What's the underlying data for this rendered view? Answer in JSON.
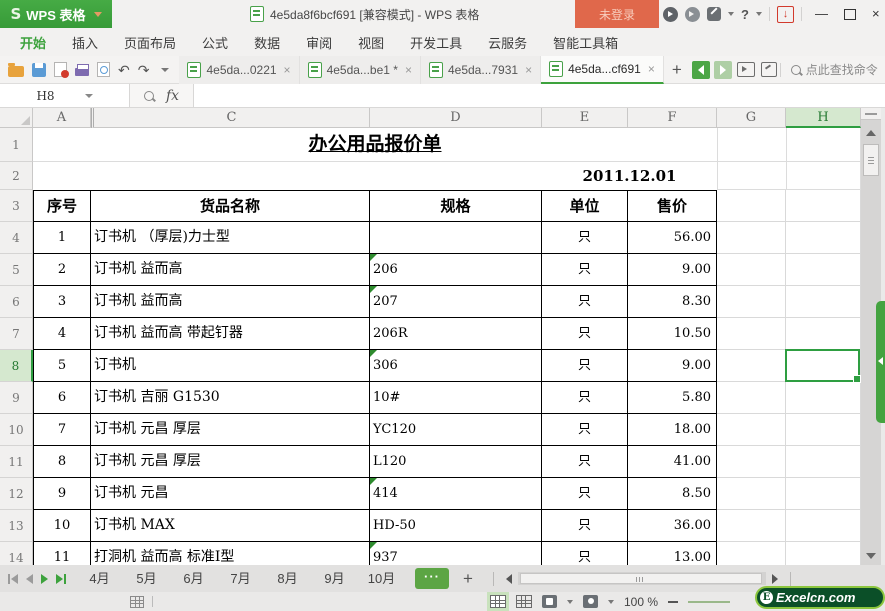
{
  "app": {
    "logo": "S",
    "name": "WPS 表格",
    "doc_title": "4e5da8f6bcf691 [兼容模式] - WPS 表格",
    "login": "未登录",
    "accent_green": "#3da23d",
    "login_orange": "#e0684b"
  },
  "menu": {
    "items": [
      "开始",
      "插入",
      "页面布局",
      "公式",
      "数据",
      "审阅",
      "视图",
      "开发工具",
      "云服务",
      "智能工具箱"
    ],
    "active_index": 0
  },
  "doc_tabs": {
    "tabs": [
      {
        "label": "4e5da...0221",
        "active": false
      },
      {
        "label": "4e5da...be1 *",
        "active": false
      },
      {
        "label": "4e5da...7931",
        "active": false
      },
      {
        "label": "4e5da...cf691",
        "active": true
      }
    ],
    "search_placeholder": "点此查找命令"
  },
  "formula_bar": {
    "name_box": "H8",
    "fx_label": "fx",
    "formula_value": ""
  },
  "grid": {
    "column_headers": [
      "A",
      "C",
      "D",
      "E",
      "F",
      "G",
      "H"
    ],
    "row_numbers": [
      1,
      2,
      3,
      4,
      5,
      6,
      7,
      8,
      9,
      10,
      11,
      12,
      13,
      14
    ],
    "selected_cell": "H8",
    "selected_column": "H",
    "selected_row_number": 8,
    "title": "办公用品报价单",
    "date": "2011.12.01",
    "table_headers": {
      "no": "序号",
      "name": "货品名称",
      "spec": "规格",
      "unit": "单位",
      "price": "售价"
    },
    "rows": [
      {
        "no": "1",
        "name": "订书机 （厚层)力士型",
        "spec": "",
        "unit": "只",
        "price": "56.00",
        "flag": false
      },
      {
        "no": "2",
        "name": "订书机 益而高",
        "spec": "206",
        "unit": "只",
        "price": "9.00",
        "flag": true
      },
      {
        "no": "3",
        "name": "订书机 益而高",
        "spec": "207",
        "unit": "只",
        "price": "8.30",
        "flag": true
      },
      {
        "no": "4",
        "name": "订书机 益而高 带起钉器",
        "spec": "206R",
        "unit": "只",
        "price": "10.50",
        "flag": false
      },
      {
        "no": "5",
        "name": "订书机",
        "spec": "306",
        "unit": "只",
        "price": "9.00",
        "flag": true
      },
      {
        "no": "6",
        "name": "订书机 吉丽 G1530",
        "spec": "10#",
        "unit": "只",
        "price": "5.80",
        "flag": false
      },
      {
        "no": "7",
        "name": "订书机 元昌 厚层",
        "spec": "YC120",
        "unit": "只",
        "price": "18.00",
        "flag": false
      },
      {
        "no": "8",
        "name": "订书机 元昌 厚层",
        "spec": "L120",
        "unit": "只",
        "price": "41.00",
        "flag": false
      },
      {
        "no": "9",
        "name": "订书机 元昌",
        "spec": "414",
        "unit": "只",
        "price": "8.50",
        "flag": true
      },
      {
        "no": "10",
        "name": "订书机 MAX",
        "spec": "HD-50",
        "unit": "只",
        "price": "36.00",
        "flag": false
      },
      {
        "no": "11",
        "name": "打洞机 益而高 标准I型",
        "spec": "937",
        "unit": "只",
        "price": "13.00",
        "flag": true
      }
    ]
  },
  "sheet_bar": {
    "tabs": [
      "4月",
      "5月",
      "6月",
      "7月",
      "8月",
      "9月",
      "10月"
    ],
    "more_label": "···",
    "add_label": "+"
  },
  "status_bar": {
    "zoom_level": "100 %",
    "watermark": {
      "badge": "E",
      "text": "Excelcn.com"
    }
  }
}
